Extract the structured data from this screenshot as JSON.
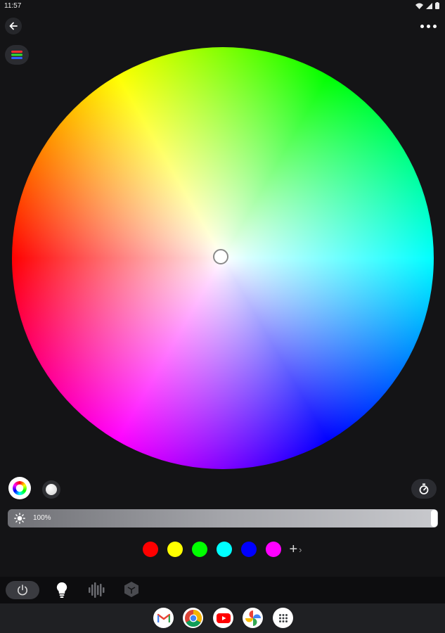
{
  "status_bar": {
    "time": "11:57",
    "icons": [
      "wifi-icon",
      "signal-icon",
      "battery-icon"
    ]
  },
  "header": {
    "back_icon": "arrow-left-icon",
    "more_icon": "more-horizontal-icon",
    "group_icon": "light-group-icon"
  },
  "color_wheel": {
    "handle_color": "#ffffff"
  },
  "mode_buttons": {
    "color_mode_icon": "color-ring-icon",
    "white_mode_icon": "white-dot-icon",
    "timer_icon": "timer-icon"
  },
  "brightness": {
    "value_text": "100%",
    "level": 1.0,
    "icon": "sun-icon"
  },
  "presets": [
    {
      "name": "red",
      "color": "#ff0000"
    },
    {
      "name": "yellow",
      "color": "#ffff00"
    },
    {
      "name": "green",
      "color": "#00ff00"
    },
    {
      "name": "cyan",
      "color": "#00ffff"
    },
    {
      "name": "blue",
      "color": "#0000ff"
    },
    {
      "name": "magenta",
      "color": "#ff00ff"
    }
  ],
  "add_preset": {
    "plus": "+",
    "chevron": "›"
  },
  "tab_bar": {
    "tabs": [
      "power-icon",
      "bulb-icon",
      "music-icon",
      "scene-icon"
    ],
    "active": "power-icon"
  },
  "dock": {
    "apps": [
      "gmail-icon",
      "chrome-icon",
      "youtube-icon",
      "photos-icon",
      "app-drawer-icon"
    ]
  }
}
